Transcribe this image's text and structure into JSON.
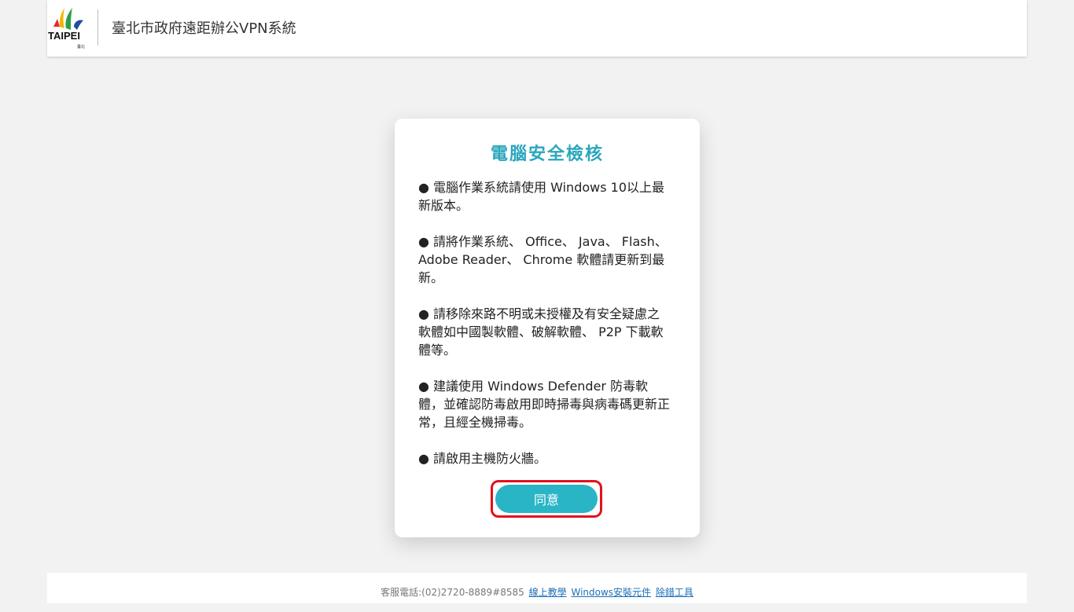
{
  "header": {
    "logo_text": "TAIPEI",
    "logo_subtext": "臺北",
    "title": "臺北市政府遠距辦公VPN系統"
  },
  "card": {
    "title": "電腦安全檢核",
    "items": [
      "● 電腦作業系統請使用 Windows 10以上最新版本。",
      "● 請將作業系統、 Office、 Java、 Flash、 Adobe Reader、 Chrome 軟體請更新到最新。",
      "● 請移除來路不明或未授權及有安全疑慮之軟體如中國製軟體、破解軟體、 P2P 下載軟體等。",
      "● 建議使用 Windows Defender 防毒軟體，並確認防毒啟用即時掃毒與病毒碼更新正常，且經全機掃毒。",
      "● 請啟用主機防火牆。"
    ],
    "agree_label": "同意"
  },
  "footer": {
    "phone_text": "客服電話:(02)2720-8889#8585",
    "links": [
      "線上教學",
      "Windows安裝元件",
      "除錯工具"
    ]
  },
  "colors": {
    "accent": "#2aa6bd",
    "button": "#2ab5c6",
    "highlight": "#e1121d",
    "link": "#1b6fb8"
  }
}
